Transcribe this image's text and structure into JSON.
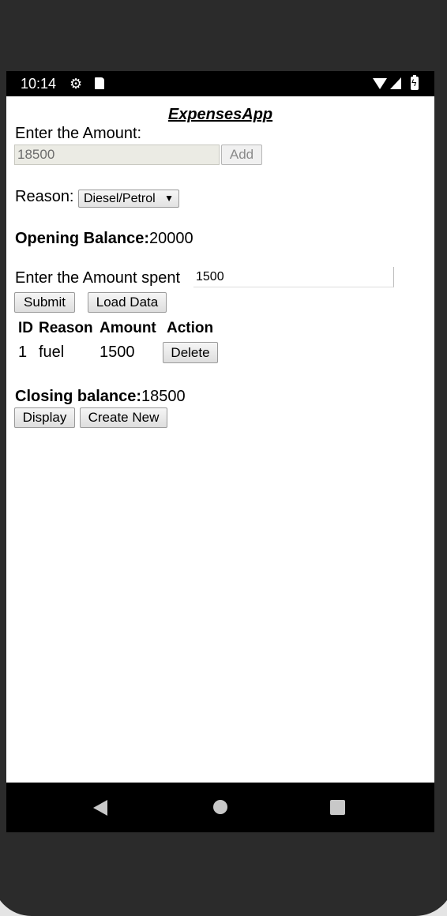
{
  "status": {
    "time": "10:14",
    "icons": [
      "settings-gear-icon",
      "sd-card-icon",
      "wifi-icon",
      "cell-signal-icon",
      "battery-charging-icon"
    ]
  },
  "app": {
    "title": "ExpensesApp",
    "amount_label": "Enter the Amount:",
    "amount_value": "18500",
    "add_label": "Add",
    "reason_label": "Reason:",
    "reason_selected": "Diesel/Petrol",
    "opening_label": "Opening Balance:",
    "opening_value": "20000",
    "spent_label": "Enter the Amount spent",
    "spent_value": "1500",
    "submit_label": "Submit",
    "load_label": "Load Data",
    "table": {
      "headers": [
        "ID",
        "Reason",
        "Amount",
        "Action"
      ],
      "rows": [
        {
          "id": "1",
          "reason": "fuel",
          "amount": "1500",
          "action": "Delete"
        }
      ]
    },
    "closing_label": "Closing balance:",
    "closing_value": "18500",
    "display_label": "Display",
    "create_label": "Create New"
  },
  "colors": {
    "status_bar": "#000000",
    "nav_bar": "#000000",
    "screen_bg": "#ffffff",
    "bezel": "#2b2b2b"
  }
}
